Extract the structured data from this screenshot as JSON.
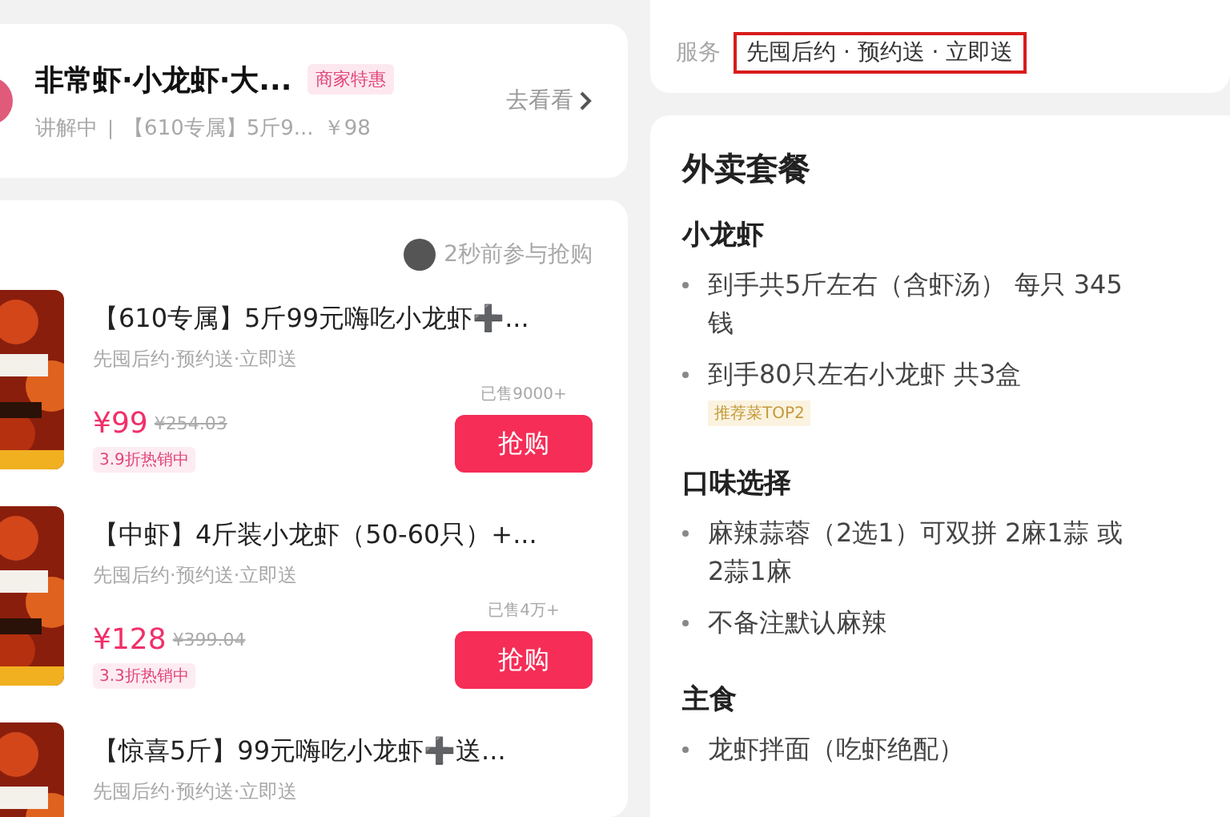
{
  "live_card": {
    "title": "非常虾·小龙虾·大...",
    "badge": "商家特惠",
    "status": "讲解中",
    "divider": "|",
    "product": "【610专属】5斤9...",
    "price": "￥98",
    "link": "去看看"
  },
  "product_list": {
    "recent_activity": "2秒前参与抢购",
    "products": [
      {
        "kind": "picture",
        "title": "【610专属】5斤99元嗨吃小龙虾➕...",
        "services": "先囤后约·预约送·立即送",
        "sold": "已售9000+",
        "price": "¥99",
        "original_price": "¥254.03",
        "discount": "3.9折热销中",
        "button": "抢购"
      },
      {
        "kind": "picture",
        "title": "【中虾】4斤装小龙虾（50-60只）+...",
        "services": "先囤后约·预约送·立即送",
        "sold": "已售4万+",
        "price": "¥128",
        "original_price": "¥399.04",
        "discount": "3.3折热销中",
        "button": "抢购"
      },
      {
        "kind": "picture",
        "title": "【惊喜5斤】99元嗨吃小龙虾➕送...",
        "services": "先囤后约·预约送·立即送"
      }
    ]
  },
  "service_card": {
    "label": "服务",
    "value": "先囤后约 · 预约送 · 立即送",
    "highlighted": true
  },
  "menu_card": {
    "title": "外卖套餐",
    "sections": [
      {
        "heading": "小龙虾",
        "items": [
          {
            "text": "到手共5斤左右（含虾汤） 每只 345钱"
          },
          {
            "text": "到手80只左右小龙虾 共3盒",
            "tag": "推荐菜TOP2"
          }
        ]
      },
      {
        "heading": "口味选择",
        "items": [
          {
            "text": "麻辣蒜蓉（2选1）可双拼 2麻1蒜 或 2蒜1麻"
          },
          {
            "text": "不备注默认麻辣"
          }
        ]
      },
      {
        "heading": "主食",
        "items": [
          {
            "text": "龙虾拌面（吃虾绝配）"
          }
        ]
      }
    ]
  }
}
